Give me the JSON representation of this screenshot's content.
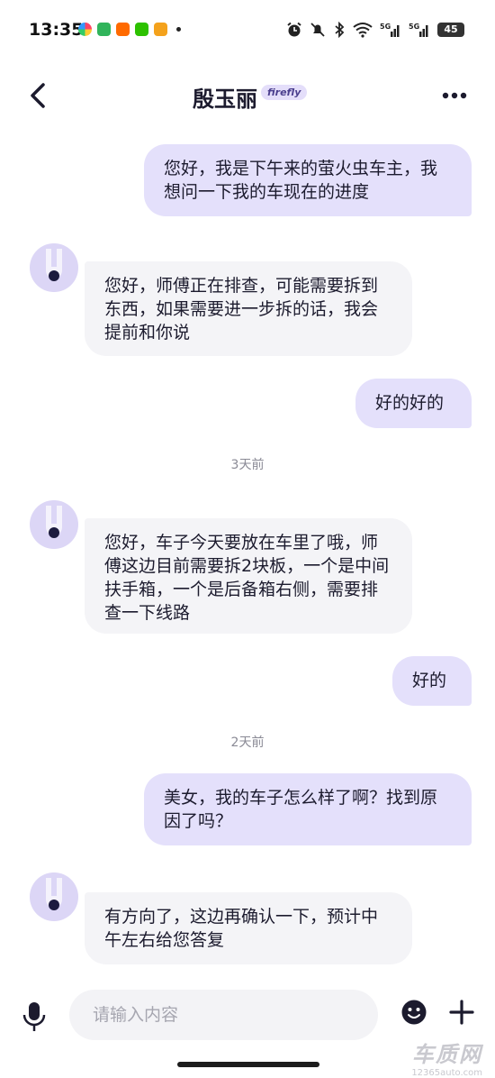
{
  "status_bar": {
    "time": "13:35",
    "battery": "45",
    "network_1": "5G",
    "network_2": "5G",
    "app_icons": [
      "photos-app-icon",
      "green-app-icon",
      "taobao-app-icon",
      "wechat-app-icon",
      "orange-app-icon"
    ]
  },
  "header": {
    "title": "殷玉丽",
    "brand": "firefly"
  },
  "messages": [
    {
      "direction": "out",
      "text": "您好，我是下午来的萤火虫车主，我想问一下我的车现在的进度"
    },
    {
      "direction": "in",
      "text": "您好，师傅正在排查，可能需要拆到东西，如果需要进一步拆的话，我会提前和你说"
    },
    {
      "direction": "out",
      "text": "好的好的"
    },
    {
      "direction": "in",
      "text": "您好，车子今天要放在车里了哦，师傅这边目前需要拆2块板，一个是中间扶手箱，一个是后备箱右侧，需要排查一下线路"
    },
    {
      "direction": "out",
      "text": "好的"
    },
    {
      "direction": "out",
      "text": "美女，我的车子怎么样了啊？找到原因了吗？"
    },
    {
      "direction": "in",
      "text": "有方向了，这边再确认一下，预计中午左右给您答复"
    }
  ],
  "date_separators": [
    "3天前",
    "2天前"
  ],
  "input": {
    "placeholder": "请输入内容"
  },
  "watermark": {
    "title": "车质网",
    "url": "12365auto.com"
  },
  "colors": {
    "outgoing_bubble": "#e4e0fb",
    "incoming_bubble": "#f4f4f7",
    "avatar_bg": "#dcd6f6",
    "accent": "#4b3f8e"
  }
}
